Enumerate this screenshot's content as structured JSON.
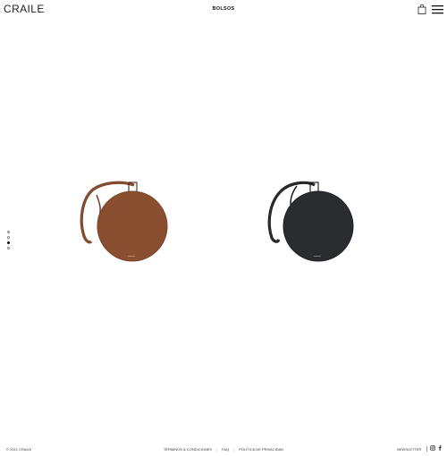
{
  "header": {
    "logo": "CRAILE",
    "nav_title": "BOLSOS",
    "cart_icon": "shopping-bag-icon",
    "menu_icon": "hamburger-menu-icon"
  },
  "carousel": {
    "slide_count": 4,
    "active_index": 2
  },
  "products": [
    {
      "name": "brown round crossbody bag",
      "color": "#8a4f31"
    },
    {
      "name": "black round crossbody bag",
      "color": "#2a2c30"
    }
  ],
  "footer": {
    "copyright": "© 2021 CRAILE",
    "links": [
      "TÉRMINOS & CONDICIONES",
      "FAQ",
      "POLÍTICA DE PRIVACIDAD"
    ],
    "newsletter": "NEWSLETTER",
    "social_icons": [
      "instagram-icon",
      "facebook-icon"
    ]
  }
}
